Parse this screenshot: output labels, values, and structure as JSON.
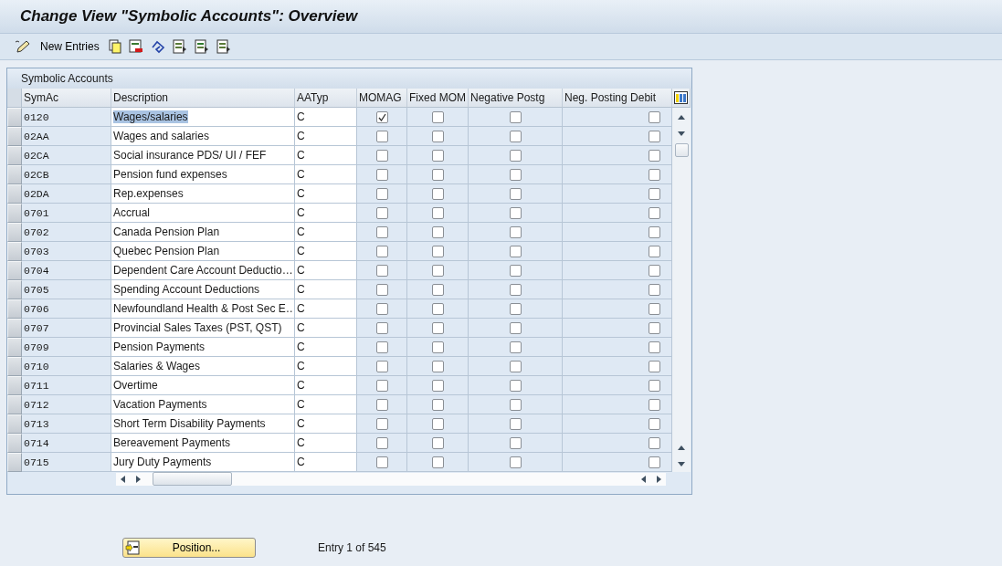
{
  "window": {
    "title": "Change View \"Symbolic Accounts\": Overview"
  },
  "toolbar": {
    "new_entries": "New Entries"
  },
  "table": {
    "title": "Symbolic Accounts",
    "columns": [
      {
        "label": "SymAc",
        "kind": "code"
      },
      {
        "label": "Description",
        "kind": "text"
      },
      {
        "label": "AATyp",
        "kind": "text"
      },
      {
        "label": "MOMAG",
        "kind": "check"
      },
      {
        "label": "Fixed MOM",
        "kind": "check"
      },
      {
        "label": "Negative Postg",
        "kind": "check"
      },
      {
        "label": "Neg. Posting Debit",
        "kind": "checkright"
      }
    ],
    "rows": [
      {
        "cells": [
          "0120",
          "Wages/salaries",
          "C"
        ],
        "checks": [
          true,
          false,
          false,
          false
        ],
        "highlighted": true
      },
      {
        "cells": [
          "02AA",
          "Wages and salaries",
          "C"
        ],
        "checks": [
          false,
          false,
          false,
          false
        ],
        "highlighted": false
      },
      {
        "cells": [
          "02CA",
          "Social insurance PDS/ UI / FEF",
          "C"
        ],
        "checks": [
          false,
          false,
          false,
          false
        ],
        "highlighted": false
      },
      {
        "cells": [
          "02CB",
          "Pension fund expenses",
          "C"
        ],
        "checks": [
          false,
          false,
          false,
          false
        ],
        "highlighted": false
      },
      {
        "cells": [
          "02DA",
          "Rep.expenses",
          "C"
        ],
        "checks": [
          false,
          false,
          false,
          false
        ],
        "highlighted": false
      },
      {
        "cells": [
          "0701",
          "Accrual",
          "C"
        ],
        "checks": [
          false,
          false,
          false,
          false
        ],
        "highlighted": false
      },
      {
        "cells": [
          "0702",
          "Canada Pension Plan",
          "C"
        ],
        "checks": [
          false,
          false,
          false,
          false
        ],
        "highlighted": false
      },
      {
        "cells": [
          "0703",
          "Quebec Pension Plan",
          "C"
        ],
        "checks": [
          false,
          false,
          false,
          false
        ],
        "highlighted": false
      },
      {
        "cells": [
          "0704",
          "Dependent Care Account Deductio…",
          "C"
        ],
        "checks": [
          false,
          false,
          false,
          false
        ],
        "highlighted": false
      },
      {
        "cells": [
          "0705",
          "Spending Account Deductions",
          "C"
        ],
        "checks": [
          false,
          false,
          false,
          false
        ],
        "highlighted": false
      },
      {
        "cells": [
          "0706",
          "Newfoundland Health & Post Sec E…",
          "C"
        ],
        "checks": [
          false,
          false,
          false,
          false
        ],
        "highlighted": false
      },
      {
        "cells": [
          "0707",
          "Provincial Sales Taxes (PST, QST)",
          "C"
        ],
        "checks": [
          false,
          false,
          false,
          false
        ],
        "highlighted": false
      },
      {
        "cells": [
          "0709",
          "Pension Payments",
          "C"
        ],
        "checks": [
          false,
          false,
          false,
          false
        ],
        "highlighted": false
      },
      {
        "cells": [
          "0710",
          "Salaries & Wages",
          "C"
        ],
        "checks": [
          false,
          false,
          false,
          false
        ],
        "highlighted": false
      },
      {
        "cells": [
          "0711",
          "Overtime",
          "C"
        ],
        "checks": [
          false,
          false,
          false,
          false
        ],
        "highlighted": false
      },
      {
        "cells": [
          "0712",
          "Vacation Payments",
          "C"
        ],
        "checks": [
          false,
          false,
          false,
          false
        ],
        "highlighted": false
      },
      {
        "cells": [
          "0713",
          "Short Term Disability Payments",
          "C"
        ],
        "checks": [
          false,
          false,
          false,
          false
        ],
        "highlighted": false
      },
      {
        "cells": [
          "0714",
          "Bereavement Payments",
          "C"
        ],
        "checks": [
          false,
          false,
          false,
          false
        ],
        "highlighted": false
      },
      {
        "cells": [
          "0715",
          "Jury Duty Payments",
          "C"
        ],
        "checks": [
          false,
          false,
          false,
          false
        ],
        "highlighted": false
      }
    ]
  },
  "footer": {
    "position_button": "Position...",
    "entry_info": "Entry 1 of 545"
  }
}
